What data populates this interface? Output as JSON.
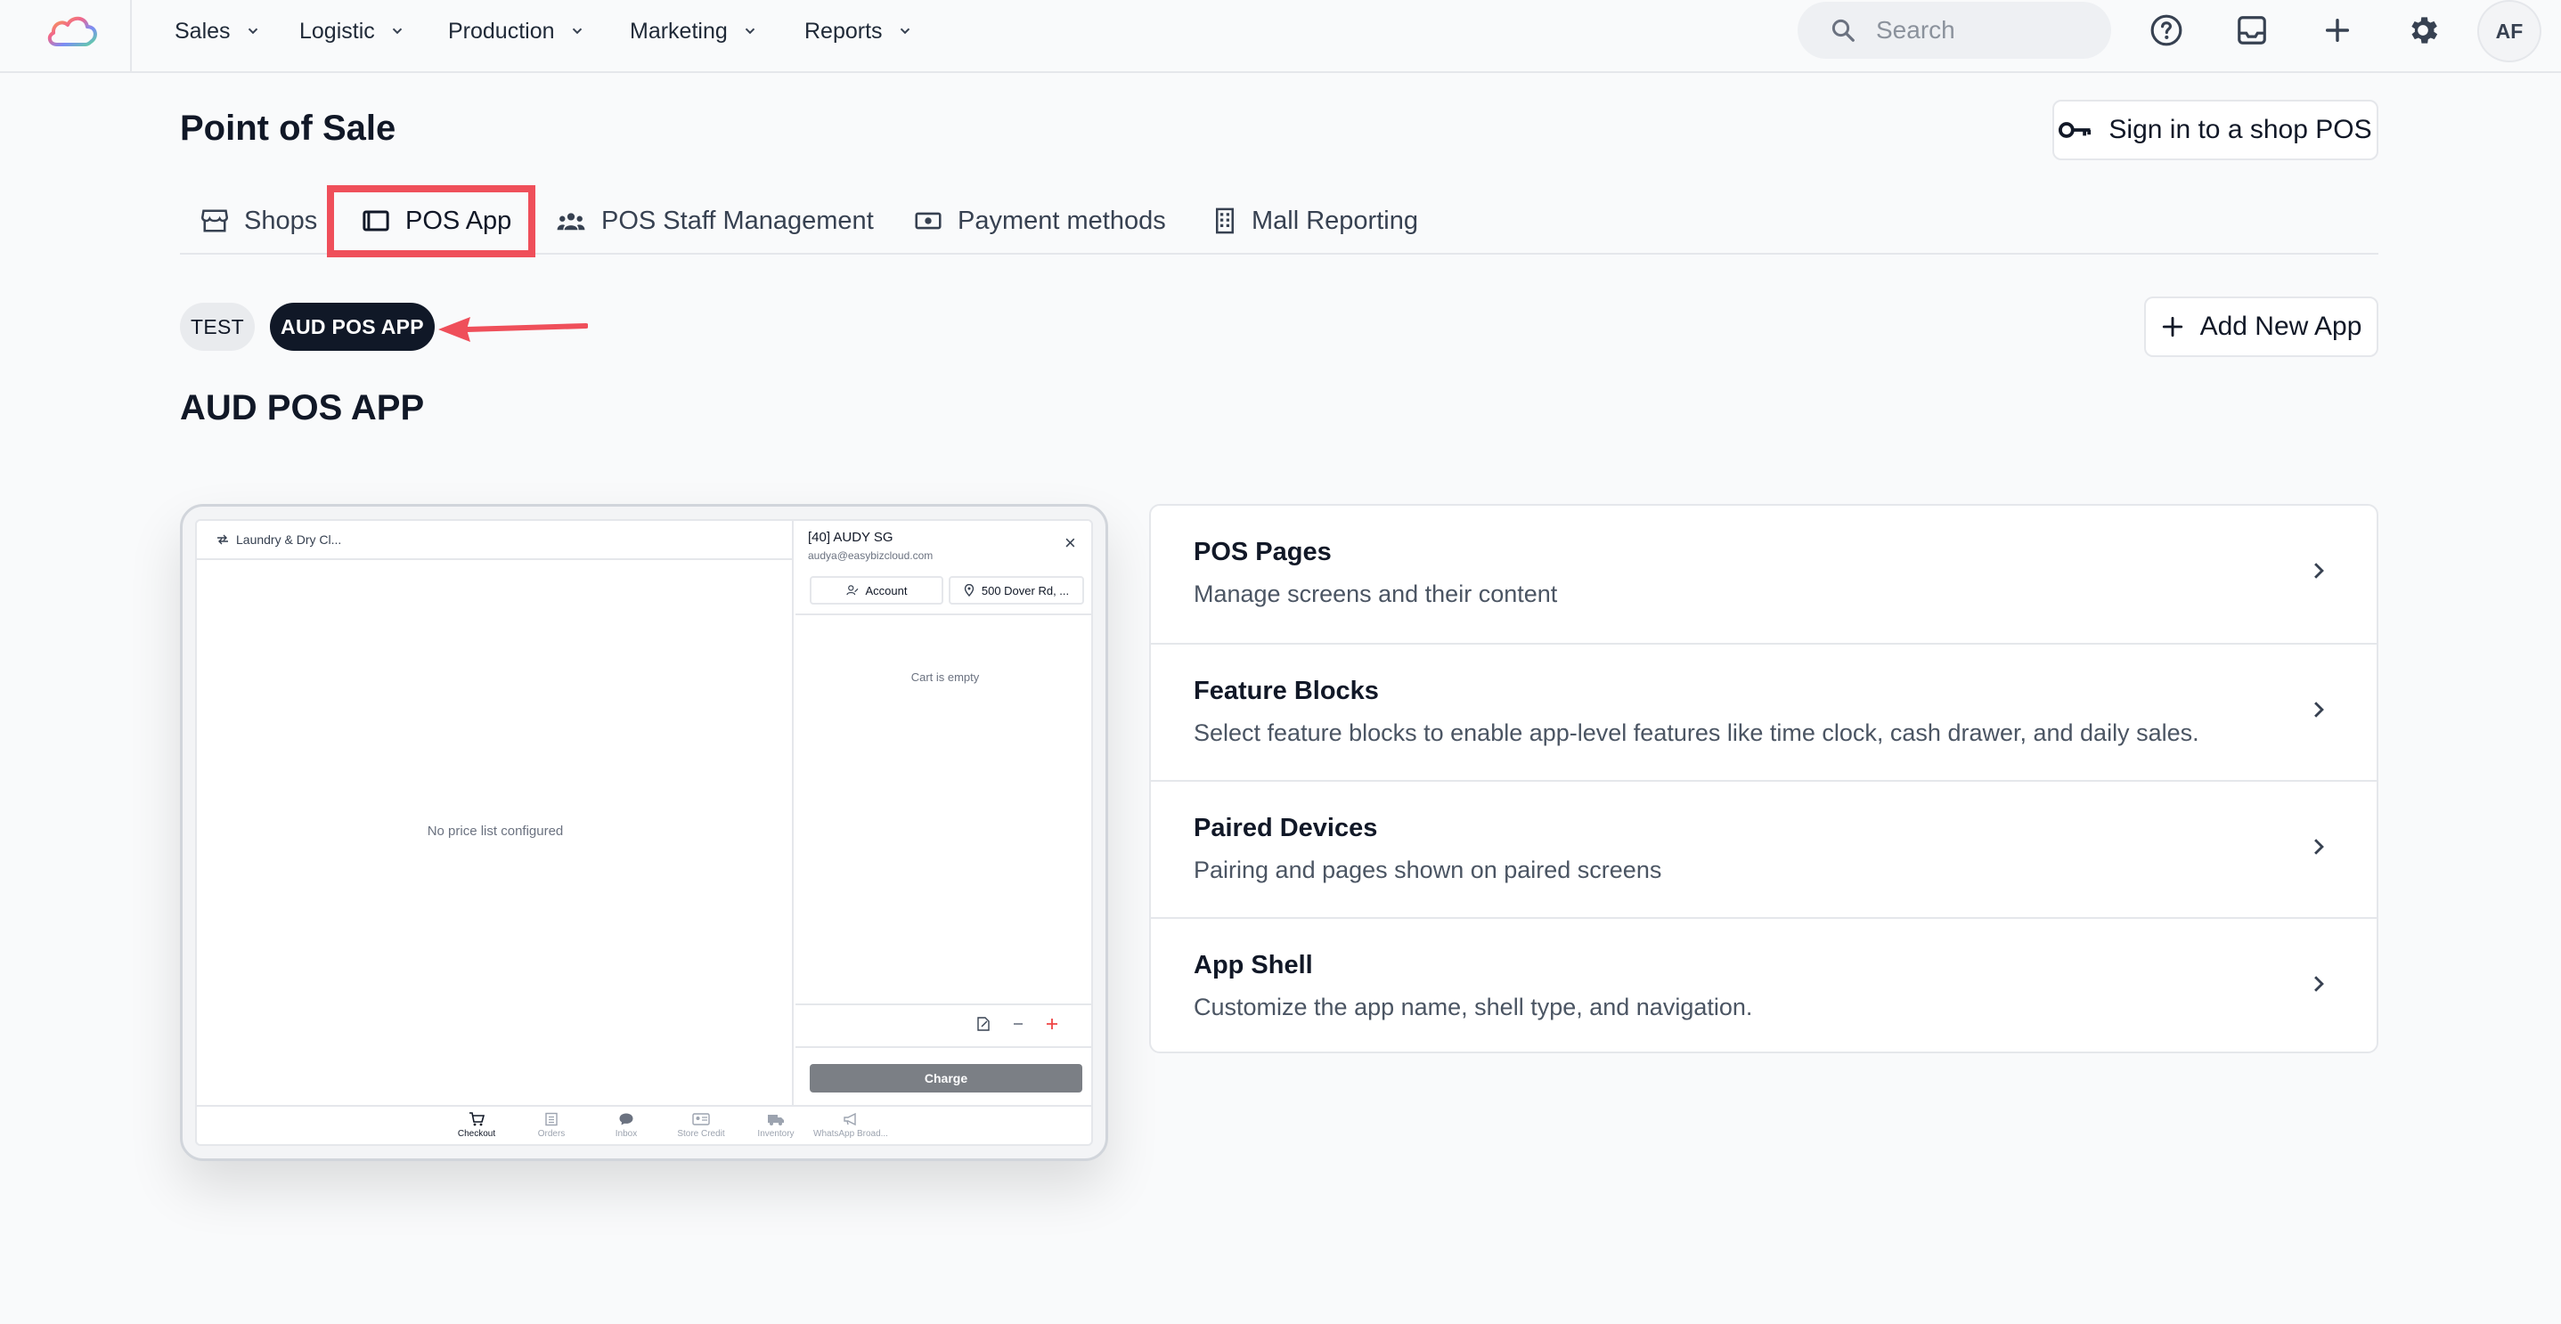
{
  "nav": {
    "items": [
      {
        "label": "Sales"
      },
      {
        "label": "Logistic"
      },
      {
        "label": "Production"
      },
      {
        "label": "Marketing"
      },
      {
        "label": "Reports"
      }
    ],
    "search_placeholder": "Search",
    "avatar_initials": "AF"
  },
  "page": {
    "title": "Point of Sale",
    "signin_label": "Sign in to a shop POS",
    "add_app_label": "Add New App",
    "section_title": "AUD POS APP"
  },
  "tabs": [
    {
      "label": "Shops",
      "icon": "storefront-icon",
      "active": false
    },
    {
      "label": "POS App",
      "icon": "tablet-icon",
      "active": true
    },
    {
      "label": "POS Staff Management",
      "icon": "people-icon",
      "active": false
    },
    {
      "label": "Payment methods",
      "icon": "banknote-icon",
      "active": false
    },
    {
      "label": "Mall Reporting",
      "icon": "building-icon",
      "active": false
    }
  ],
  "apps": [
    {
      "label": "TEST",
      "selected": false
    },
    {
      "label": "AUD POS APP",
      "selected": true
    }
  ],
  "preview": {
    "store_label": "Laundry & Dry Cl...",
    "no_price_list": "No price list configured",
    "customer_name": "[40] AUDY SG",
    "customer_email": "audya@easybizcloud.com",
    "close_glyph": "×",
    "account_label": "Account",
    "address_label": "500 Dover Rd, ...",
    "cart_empty": "Cart is empty",
    "charge_label": "Charge",
    "bottom_nav": [
      {
        "label": "Checkout",
        "active": true
      },
      {
        "label": "Orders",
        "active": false
      },
      {
        "label": "Inbox",
        "active": false
      },
      {
        "label": "Store Credit",
        "active": false
      },
      {
        "label": "Inventory",
        "active": false
      },
      {
        "label": "WhatsApp Broad...",
        "active": false
      }
    ]
  },
  "settings": [
    {
      "title": "POS Pages",
      "description": "Manage screens and their content"
    },
    {
      "title": "Feature Blocks",
      "description": "Select feature blocks to enable app-level features like time clock, cash drawer, and daily sales."
    },
    {
      "title": "Paired Devices",
      "description": "Pairing and pages shown on paired screens"
    },
    {
      "title": "App Shell",
      "description": "Customize the app name, shell type, and navigation."
    }
  ],
  "colors": {
    "highlight": "#ef4f5a",
    "dark": "#101827",
    "accent_red": "#ef4444"
  }
}
